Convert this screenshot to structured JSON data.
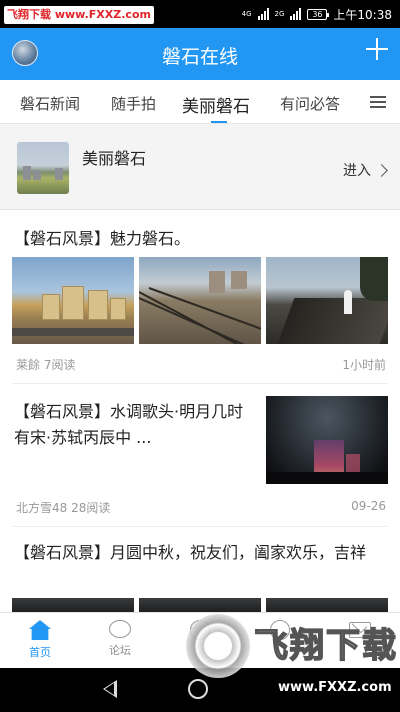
{
  "status": {
    "watermark": "飞翔下载 www.FXXZ.com",
    "network_top": "4G",
    "network_bottom": "2G",
    "battery": "36",
    "time": "上午10:38"
  },
  "appbar": {
    "title": "磐石在线"
  },
  "tabs": [
    {
      "label": "磐石新闻"
    },
    {
      "label": "随手拍"
    },
    {
      "label": "美丽磐石"
    },
    {
      "label": "有问必答"
    }
  ],
  "banner": {
    "title": "美丽磐石",
    "enter_label": "进入"
  },
  "articles": [
    {
      "title": "【磐石风景】魅力磐石。",
      "author": "莱餘",
      "reads": "7阅读",
      "time": "1小时前"
    },
    {
      "title": "【磐石风景】水调歌头·明月几时有宋·苏轼丙辰中 ...",
      "author": "北方雪48",
      "reads": "28阅读",
      "time": "09-26"
    },
    {
      "title": "【磐石风景】月圆中秋，祝友们，阖家欢乐，吉祥"
    }
  ],
  "bottom_nav": [
    {
      "label": "首页",
      "icon": "home-icon"
    },
    {
      "label": "论坛",
      "icon": "chat-bubble-icon"
    },
    {
      "label": "",
      "icon": "discover-icon"
    },
    {
      "label": "",
      "icon": "compass-icon"
    },
    {
      "label": "",
      "icon": "mail-icon"
    }
  ],
  "watermark_bottom": {
    "text": "飞翔下载",
    "url": "www.FXXZ.com"
  },
  "colors": {
    "accent": "#2196f3"
  }
}
